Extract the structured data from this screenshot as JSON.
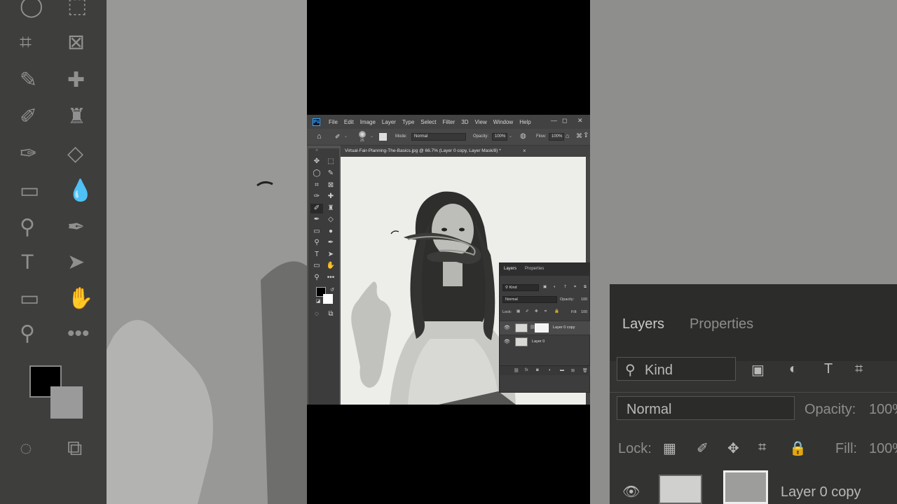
{
  "app": {
    "menu": [
      "File",
      "Edit",
      "Image",
      "Layer",
      "Type",
      "Select",
      "Filter",
      "3D",
      "View",
      "Window",
      "Help"
    ],
    "window_controls": {
      "minimize": "—",
      "maximize": "◻",
      "close": "✕"
    }
  },
  "options_bar": {
    "brush_size": "25",
    "mode_label": "Mode:",
    "mode_value": "Normal",
    "opacity_label": "Opacity:",
    "opacity_value": "100%",
    "flow_label": "Flow:",
    "flow_value": "100%"
  },
  "document": {
    "tab_title": "Virtual-Fair-Planning-The-Basics.jpg @ 66.7% (Layer 0 copy, Layer Mask/8) *",
    "close": "×"
  },
  "layers_panel": {
    "tabs": [
      "Layers",
      "Properties"
    ],
    "filter_kind": "Kind",
    "blend_mode": "Normal",
    "opacity_label": "Opacity:",
    "opacity_value": "100",
    "lock_label": "Lock:",
    "fill_label": "Fill:",
    "fill_value": "100",
    "layers": [
      {
        "name": "Layer 0 copy",
        "selected": true,
        "has_mask": true
      },
      {
        "name": "Layer 0",
        "selected": false,
        "has_mask": false
      }
    ],
    "footer_icons": [
      "link-icon",
      "fx-icon",
      "mask-icon",
      "adjustment-icon",
      "folder-icon",
      "new-layer-icon",
      "trash-icon"
    ]
  },
  "zoom_background": {
    "layers_tab": "Layers",
    "properties_tab": "Properties",
    "kind": "Kind",
    "blend_mode": "Normal",
    "opacity_label": "Opacity:",
    "opacity_value": "100%",
    "lock_label": "Lock:",
    "fill_label": "Fill:",
    "fill_value": "100%",
    "layer_name": "Layer 0 copy"
  },
  "colors": {
    "foreground": "#000000",
    "background": "#ffffff",
    "ui_dark": "#424242",
    "ui_panel": "#3d3d3d",
    "canvas_bg": "#e9eae6"
  }
}
